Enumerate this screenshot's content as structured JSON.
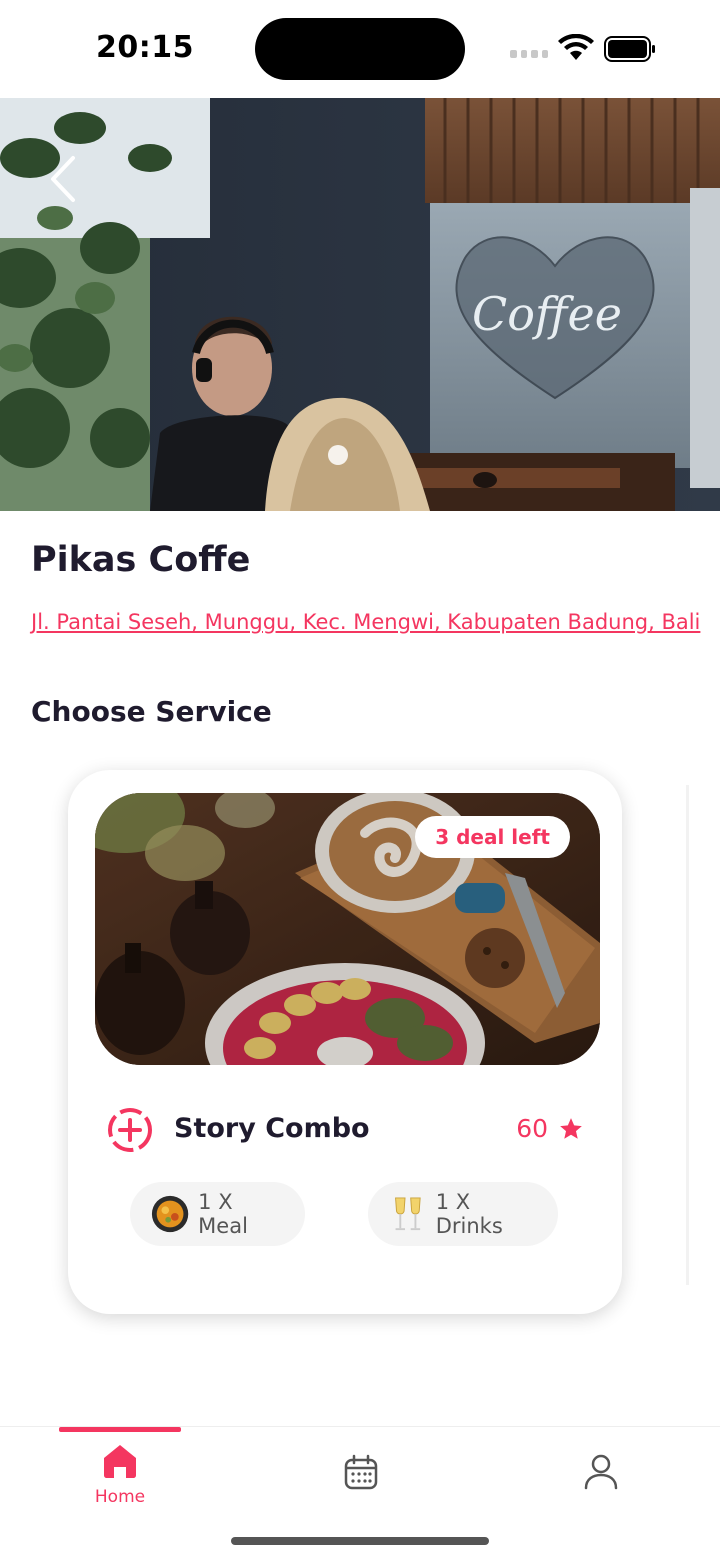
{
  "status_bar": {
    "time": "20:15"
  },
  "place": {
    "title": "Pikas Coffe",
    "address": "Jl. Pantai Seseh, Munggu, Kec. Mengwi, Kabupaten Badung, Bali",
    "hero_sign_text": "Coffee"
  },
  "services": {
    "section_title": "Choose Service",
    "card": {
      "badge": "3 deal left",
      "name": "Story Combo",
      "rating": "60",
      "items": [
        {
          "label": "1 X Meal",
          "icon": "meal-icon"
        },
        {
          "label": "1 X Drinks",
          "icon": "drinks-icon"
        }
      ]
    }
  },
  "tabs": [
    {
      "label": "Home",
      "icon": "home-icon",
      "active": true
    },
    {
      "label": "",
      "icon": "calendar-icon",
      "active": false
    },
    {
      "label": "",
      "icon": "profile-icon",
      "active": false
    }
  ],
  "colors": {
    "accent": "#f43660",
    "text": "#1f1b2e"
  }
}
